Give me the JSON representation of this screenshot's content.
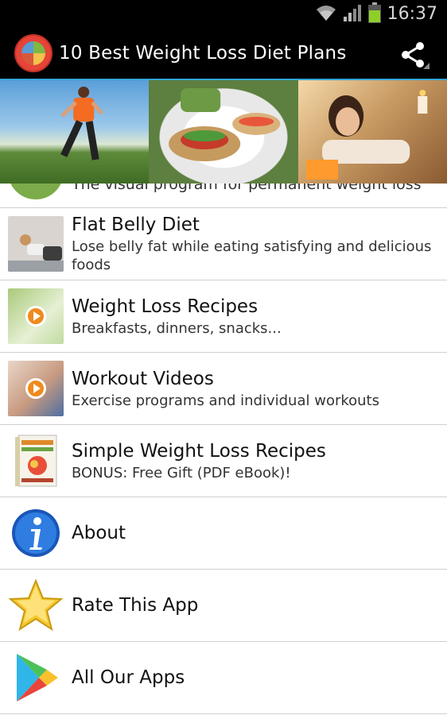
{
  "status": {
    "time": "16:37",
    "battery_color": "#8fce2a"
  },
  "app": {
    "title": "10 Best Weight Loss Diet Plans",
    "accent": "#33a6d8"
  },
  "list": {
    "partial_row_text": "The visual program for permanent weight loss",
    "items": [
      {
        "title": "Flat Belly Diet",
        "subtitle": "Lose belly fat while eating satisfying and delicious foods",
        "icon": "woman-crunch-photo"
      },
      {
        "title": "Weight Loss Recipes",
        "subtitle": "Breakfasts, dinners, snacks...",
        "icon": "food-video-thumbnail"
      },
      {
        "title": "Workout Videos",
        "subtitle": "Exercise programs and individual workouts",
        "icon": "workout-video-thumbnail"
      },
      {
        "title": "Simple Weight Loss Recipes",
        "subtitle": "BONUS: Free Gift (PDF eBook)!",
        "icon": "ebook-cover"
      }
    ],
    "links": [
      {
        "title": "About",
        "icon": "info-icon"
      },
      {
        "title": "Rate This App",
        "icon": "star-icon"
      },
      {
        "title": "All Our Apps",
        "icon": "play-store-icon"
      }
    ]
  }
}
